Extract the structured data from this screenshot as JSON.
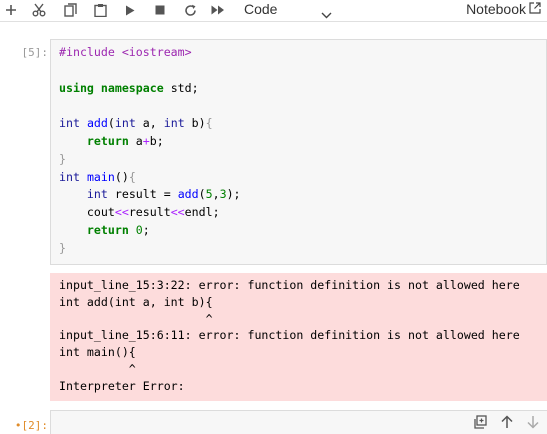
{
  "toolbar": {
    "buttons": [
      "add-icon",
      "cut-icon",
      "copy-icon",
      "paste-icon",
      "run-icon",
      "stop-icon",
      "restart-icon",
      "fast-forward-icon"
    ],
    "cell_type": "Code",
    "notebook_label": "Notebook"
  },
  "cells": [
    {
      "prompt": "[5]:",
      "code": [
        "#include <iostream>",
        "",
        "using namespace std;",
        "",
        "int add(int a, int b){",
        "    return a+b;",
        "}",
        "int main(){",
        "    int result = add(5,3);",
        "    cout<<result<<endl;",
        "    return 0;",
        "}"
      ],
      "output": "input_line_15:3:22: error: function definition is not allowed here\nint add(int a, int b){\n                     ^\ninput_line_15:6:11: error: function definition is not allowed here\nint main(){\n          ^\nInterpreter Error:"
    },
    {
      "prompt": "[2]:",
      "prompt_marker": "•"
    }
  ],
  "cell_toolbar": [
    "duplicate-icon",
    "move-up-icon",
    "move-down-icon"
  ],
  "colors": {
    "keyword": "#008000",
    "preprocessor": "#9c27b0",
    "function": "#0000ff",
    "error_bg": "#fddcdc",
    "active_prompt": "#e08c2a"
  }
}
